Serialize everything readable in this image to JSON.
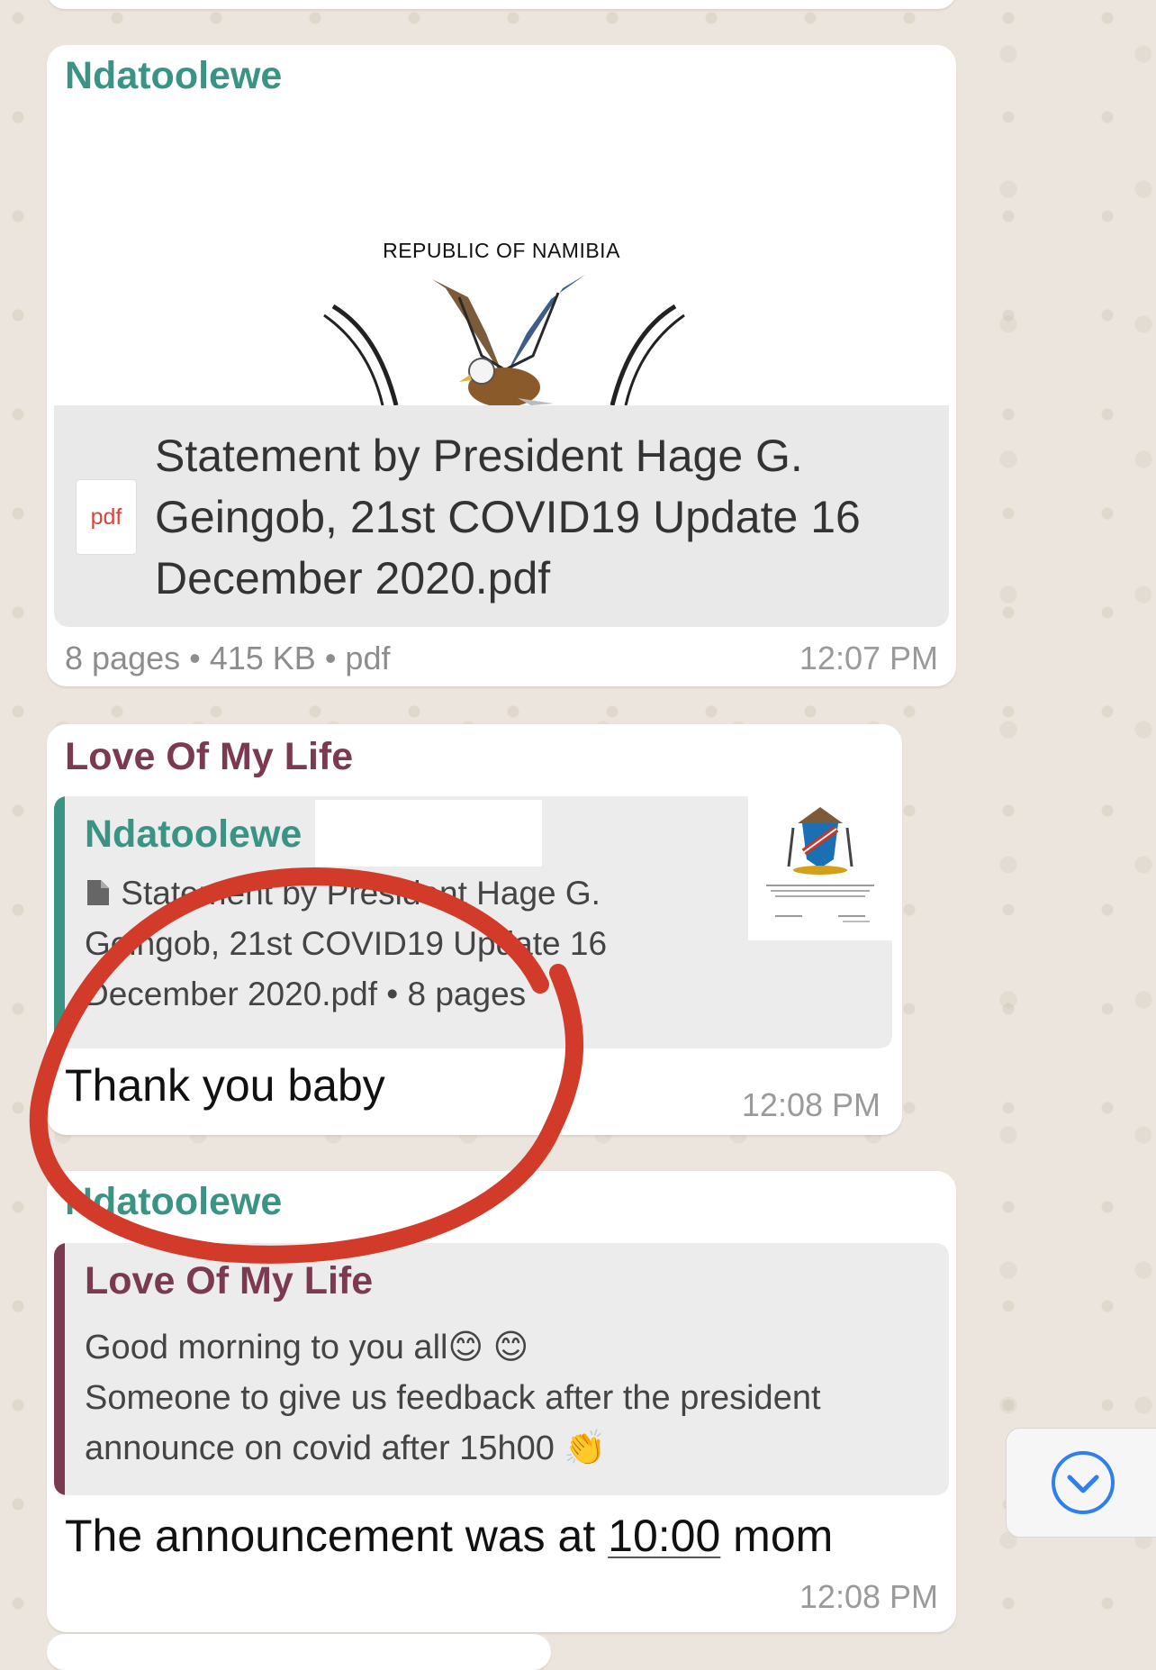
{
  "messages": [
    {
      "sender": "Ndatoolewe",
      "document": {
        "preview_heading": "REPUBLIC OF NAMIBIA",
        "file_type_label": "pdf",
        "file_name": "Statement by President Hage G. Geingob, 21st COVID19 Update 16 December 2020.pdf",
        "pages": "8 pages",
        "size": "415 KB",
        "type": "pdf"
      },
      "time": "12:07 PM"
    },
    {
      "sender": "Love Of My Life",
      "reply_to": {
        "sender": "Ndatoolewe",
        "text_line1": "Statement by President Hage G.",
        "text_line2": "Geingob, 21st COVID19 Update 16",
        "text_line3": "December 2020.pdf • 8 pages"
      },
      "text": "Thank you baby",
      "time": "12:08 PM"
    },
    {
      "sender": "Ndatoolewe",
      "reply_to": {
        "sender": "Love Of My Life",
        "text_line1": "Good morning to you all😊 😊",
        "text_line2": "Someone to give us feedback after  the president",
        "text_line3": "announce on covid after 15h00 👏"
      },
      "text_before": "The announcement was at ",
      "text_time_link": "10:00",
      "text_after": " mom",
      "time": "12:08 PM"
    }
  ],
  "meta_separator": " • ",
  "colors": {
    "teal_sender": "#3a9484",
    "maroon_sender": "#7b3a52",
    "annotation_red": "#d23a2a",
    "scroll_icon": "#2f80ed"
  },
  "icons": [
    "pdf-file-icon",
    "document-icon",
    "chevron-down-circle-icon"
  ]
}
